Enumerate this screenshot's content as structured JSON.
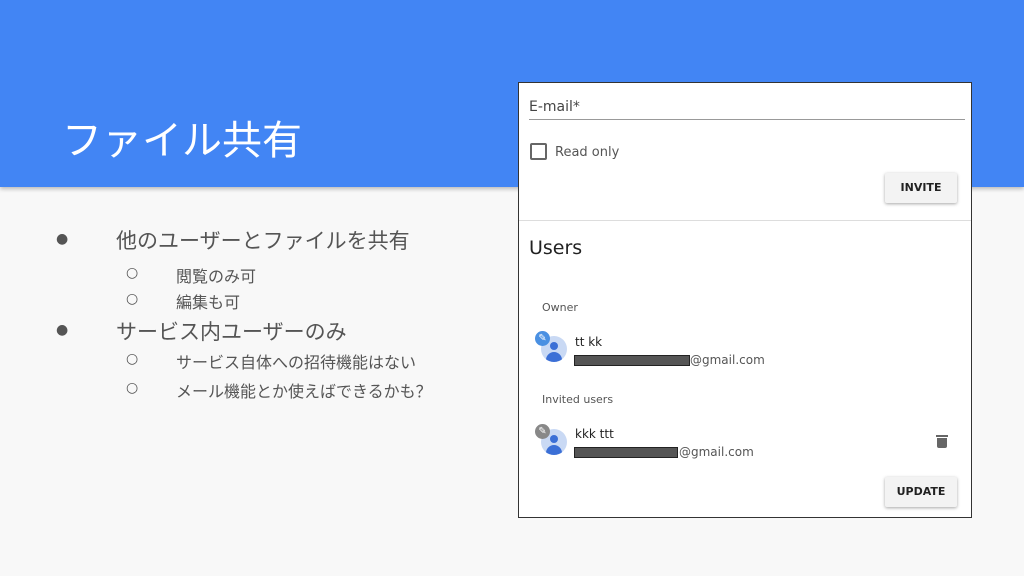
{
  "slide": {
    "title": "ファイル共有",
    "bullets": [
      {
        "text": "他のユーザーとファイルを共有",
        "children": [
          "閲覧のみ可",
          "編集も可"
        ]
      },
      {
        "text": "サービス内ユーザーのみ",
        "children": [
          "サービス自体への招待機能はない",
          "メール機能とか使えばできるかも？"
        ]
      }
    ],
    "bullet_mark": "●",
    "sub_bullet_mark": "○"
  },
  "share_panel": {
    "email_placeholder": "E-mail*",
    "read_only_label": "Read only",
    "read_only_checked": false,
    "invite_label": "INVITE",
    "users_heading": "Users",
    "owner_label": "Owner",
    "owner": {
      "name": "tt kk",
      "email_suffix": "@gmail.com"
    },
    "invited_label": "Invited users",
    "invited": [
      {
        "name": "kkk ttt",
        "email_suffix": "@gmail.com"
      }
    ],
    "update_label": "UPDATE"
  },
  "colors": {
    "header": "#4285f4",
    "owner_badge": "#4a90e2",
    "invited_badge": "#888888"
  },
  "icons": {
    "edit": "pencil-icon",
    "delete": "trash-icon",
    "avatar": "person-icon"
  }
}
